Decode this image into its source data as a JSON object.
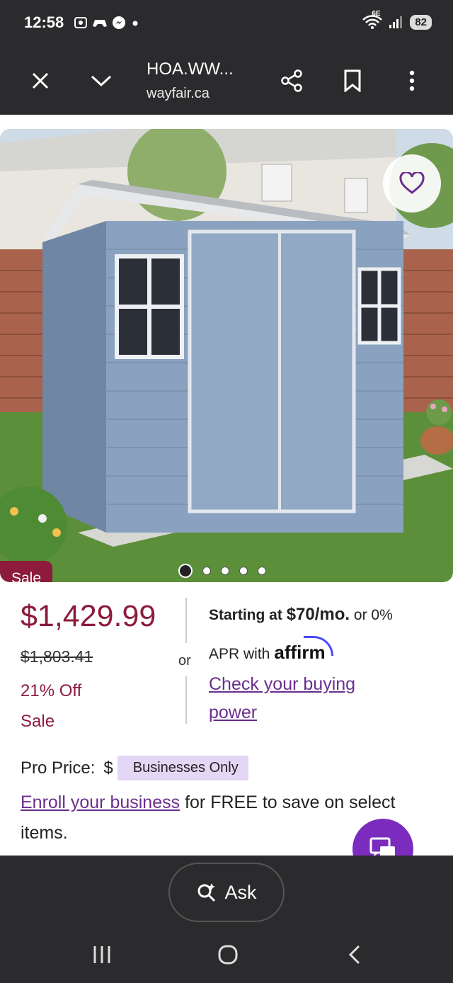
{
  "status": {
    "time": "12:58",
    "icons": [
      "screen-record-icon",
      "game-icon",
      "messenger-icon",
      "dot-icon"
    ],
    "network": "6E",
    "battery": "82"
  },
  "browser": {
    "title": "HOA.WW...",
    "url": "wayfair.ca",
    "icons": [
      "close-icon",
      "chevron-down-icon",
      "share-icon",
      "bookmark-icon",
      "more-icon"
    ]
  },
  "product": {
    "sale_badge": "Sale",
    "carousel": {
      "count": 5,
      "active": 0
    },
    "price": "$1,429.99",
    "old_price": "$1,803.41",
    "discount": "21% Off",
    "sale_label": "Sale",
    "or": "or",
    "financing": {
      "prefix": "Starting at",
      "amount": "$70/mo.",
      "suffix": "or 0%",
      "apr": "APR with",
      "provider": "affirm",
      "link": "Check your buying power"
    },
    "pro": {
      "label": "Pro Price:",
      "currency_partial": "$",
      "badge": "Businesses Only",
      "enroll_link": "Enroll your business",
      "enroll_rest": "for FREE to save on select items."
    }
  },
  "bottom": {
    "ask_label": "Ask"
  },
  "colors": {
    "accent": "#8c1b3c",
    "link": "#6a2e8e",
    "fab": "#7b2cbf",
    "chrome": "#2b2b2e"
  }
}
